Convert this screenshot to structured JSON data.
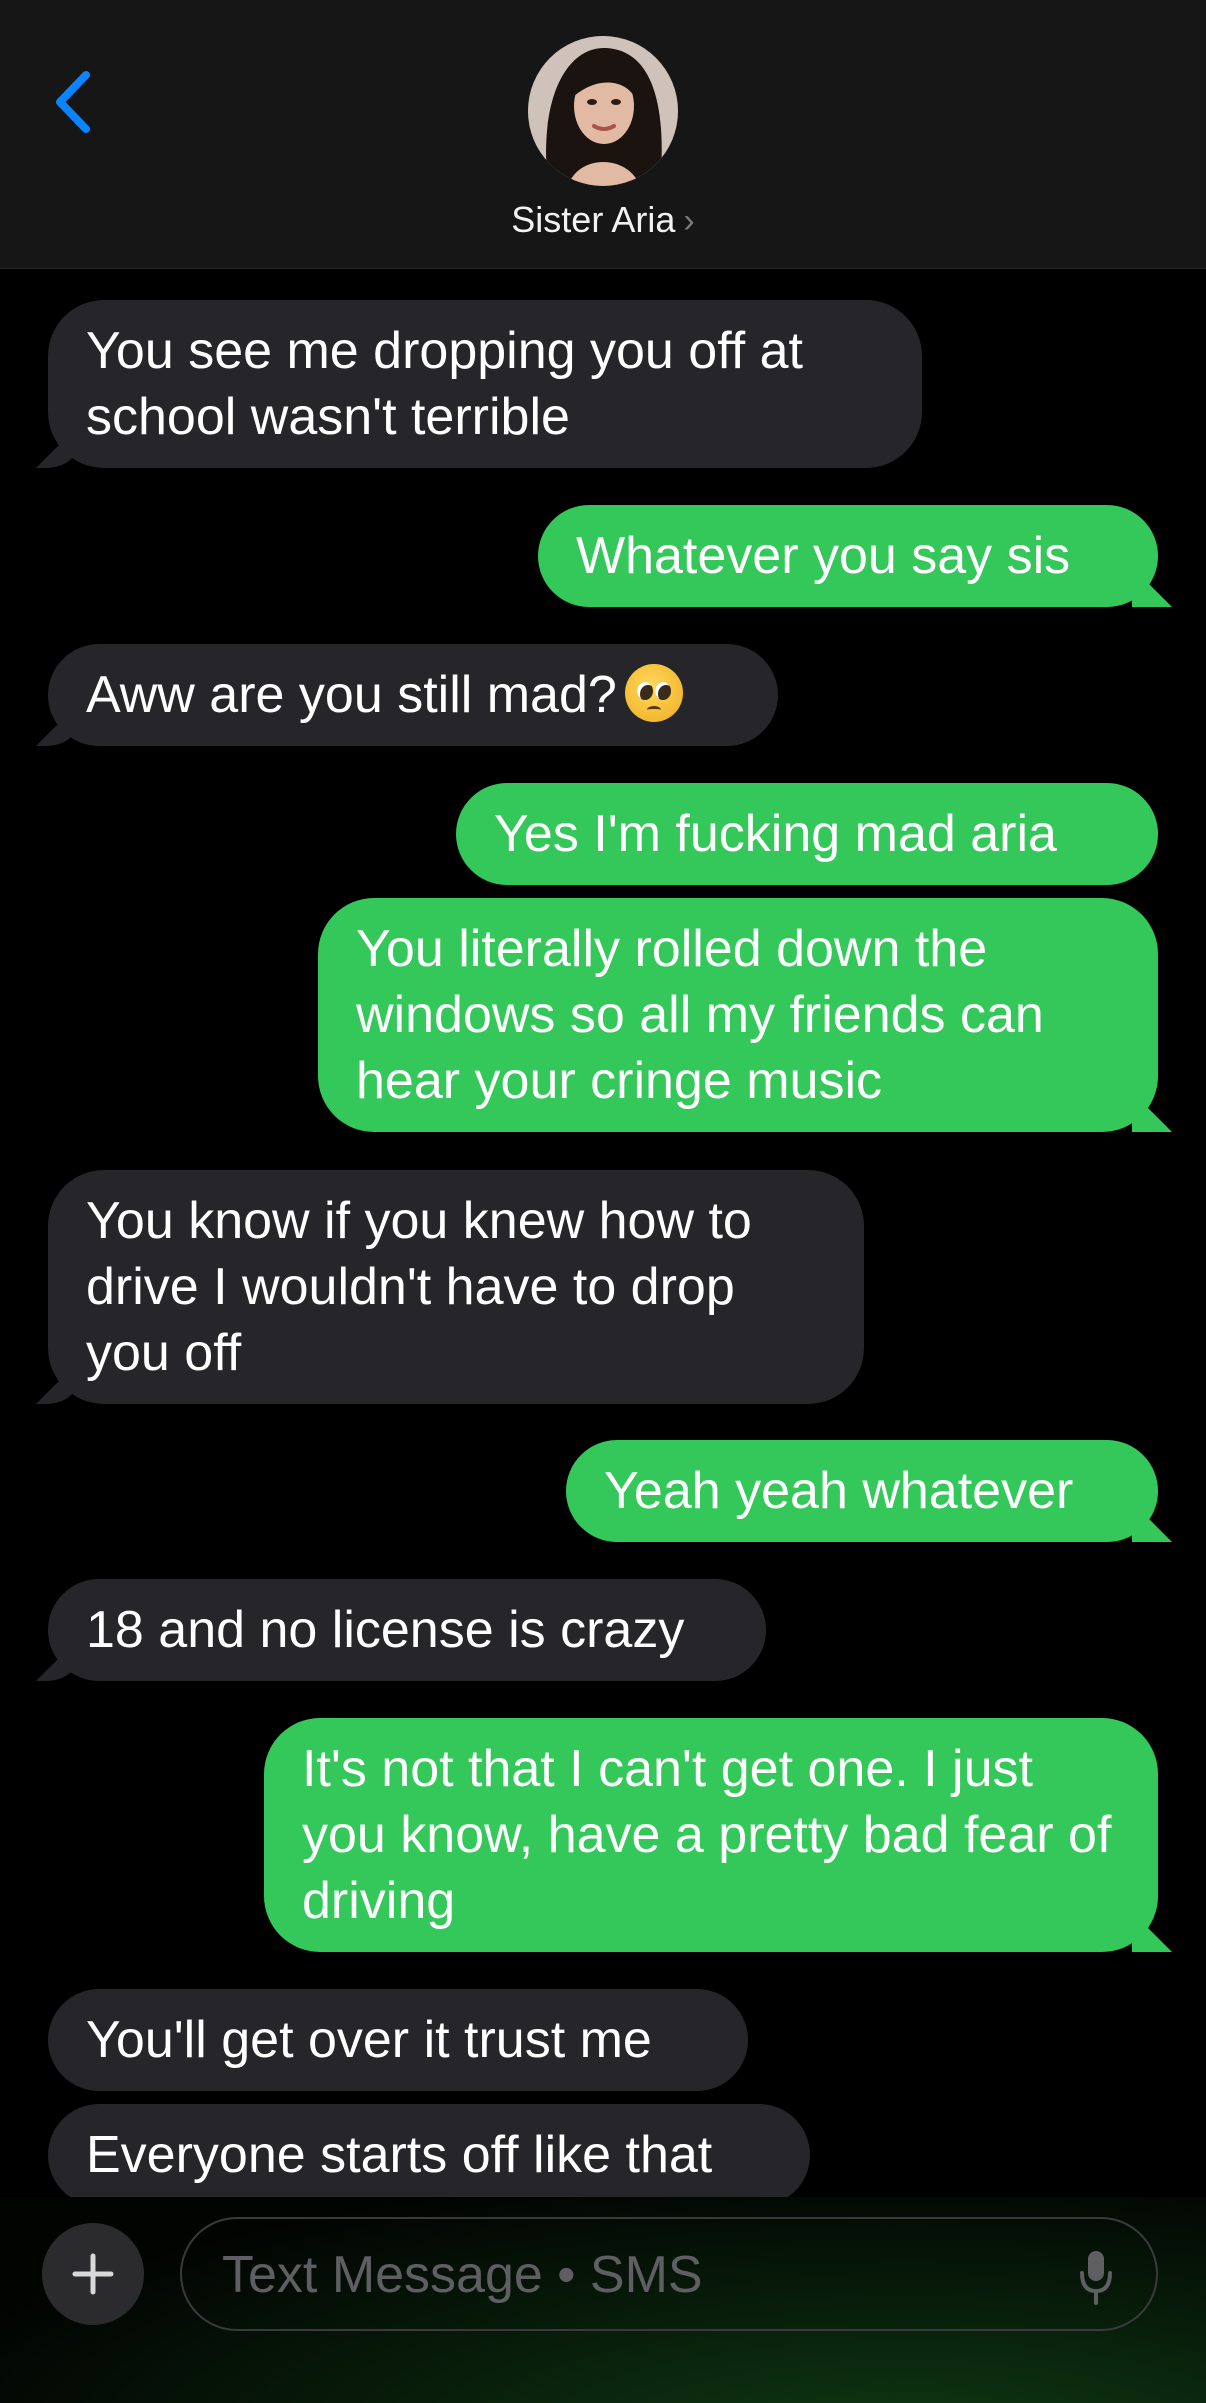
{
  "header": {
    "contact_name": "Sister Aria",
    "chevron": "›"
  },
  "messages": [
    {
      "side": "in",
      "text": "You see me dropping you off at school wasn't terrible"
    },
    {
      "side": "out",
      "text": "Whatever you say sis"
    },
    {
      "side": "in",
      "text": "Aww are you still mad?",
      "emoji": "pleading-face"
    },
    {
      "side": "out",
      "text": "Yes I'm fucking mad aria"
    },
    {
      "side": "out",
      "text": "You literally rolled down the windows so all my friends can hear your cringe music"
    },
    {
      "side": "in",
      "text": "You know if you knew how to drive I wouldn't have to drop you off"
    },
    {
      "side": "out",
      "text": "Yeah yeah whatever"
    },
    {
      "side": "in",
      "text": "18 and no license is crazy"
    },
    {
      "side": "out",
      "text": "It's not that I can't get one. I just you know, have a pretty bad fear of driving"
    },
    {
      "side": "in",
      "text": "You'll get over it trust me"
    },
    {
      "side": "in",
      "text": "Everyone starts off like that"
    }
  ],
  "composer": {
    "placeholder": "Text Message • SMS",
    "plus": "+"
  },
  "colors": {
    "incoming": "#26262a",
    "outgoing": "#34c85a",
    "accent": "#0a84ff",
    "background": "#000000"
  },
  "icons": [
    "back-chevron-icon",
    "contact-avatar",
    "plus-icon",
    "microphone-icon",
    "pleading-face-emoji"
  ]
}
